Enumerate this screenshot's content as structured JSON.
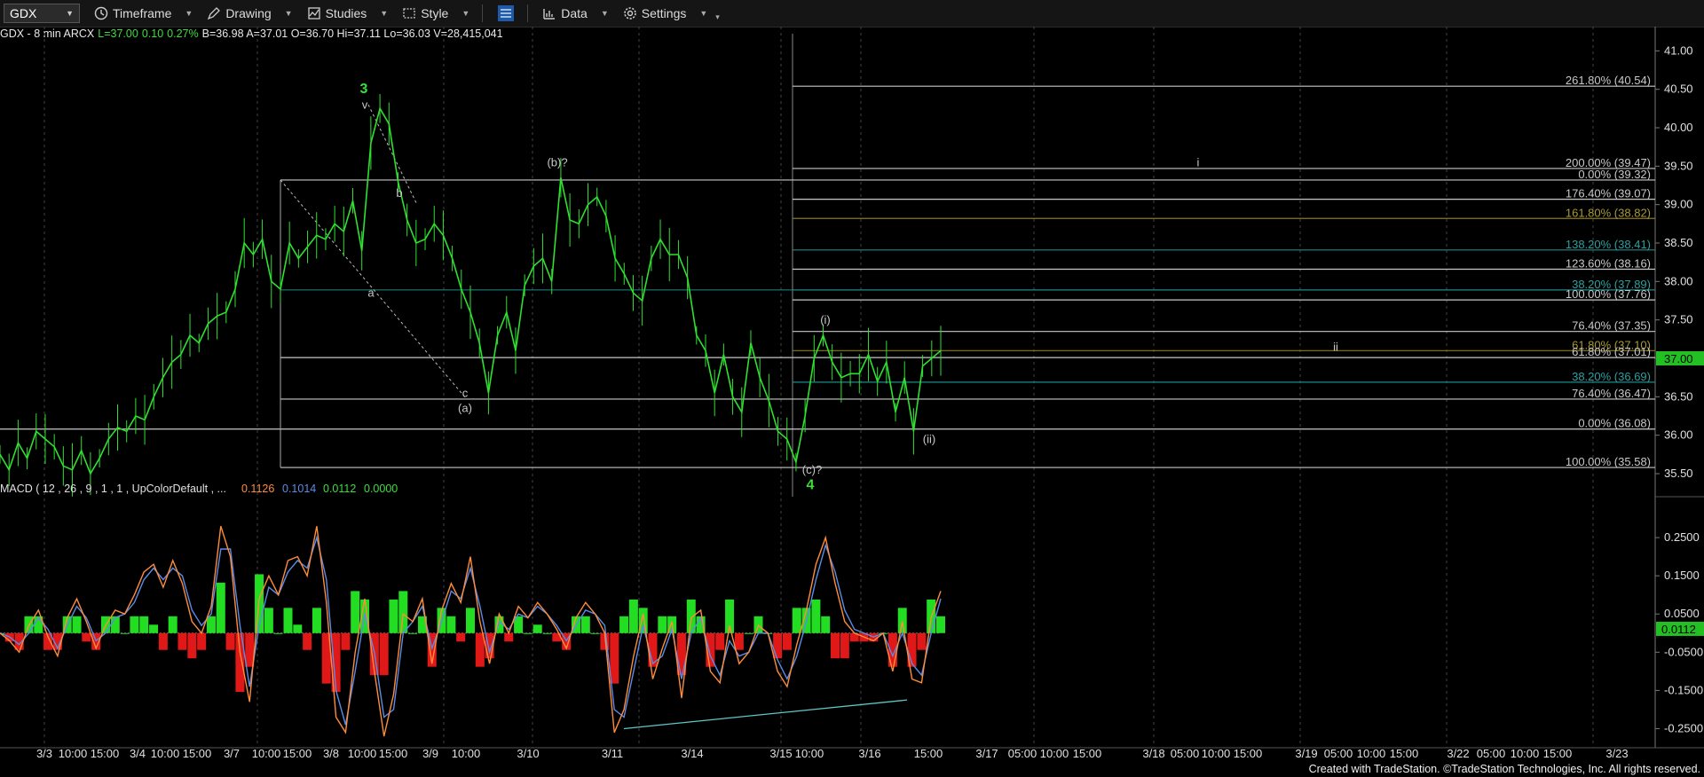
{
  "toolbar": {
    "symbol": "GDX",
    "items": [
      {
        "label": "Timeframe",
        "icon": "clock-icon"
      },
      {
        "label": "Drawing",
        "icon": "pencil-icon"
      },
      {
        "label": "Studies",
        "icon": "studies-icon"
      },
      {
        "label": "Style",
        "icon": "style-icon"
      },
      {
        "label": "Data",
        "icon": "data-icon"
      },
      {
        "label": "Settings",
        "icon": "gear-icon"
      }
    ]
  },
  "info_line": {
    "prefix": "GDX - 8 min  ARCX",
    "last": "L=37.00",
    "change": "0.10",
    "pct": "0.27%",
    "stats": "B=36.98  A=37.01  O=36.70  Hi=37.11  Lo=36.03  V=28,415,041"
  },
  "colors": {
    "price": "#2fe02f",
    "macd": "#ff8c3a",
    "signal": "#5a8ce8",
    "hist_up": "#22dd22",
    "hist_down": "#e01818",
    "fib_gray": "#c8c8c8",
    "fib_teal": "#1e8a8a",
    "fib_olive": "#8a7a1e",
    "divergence": "#5fc7c7"
  },
  "chart_data": [
    {
      "type": "line",
      "title": "GDX - 8 min",
      "ylim": [
        35.2,
        41.2
      ],
      "y_ticks": [
        "41.00",
        "40.50",
        "40.00",
        "39.50",
        "39.00",
        "38.50",
        "38.00",
        "37.50",
        "37.00",
        "36.50",
        "36.00",
        "35.50"
      ],
      "x_tick_labels": [
        "3/3",
        "10:00",
        "15:00",
        "3/4",
        "10:00",
        "15:00",
        "3/7",
        "10:00",
        "15:00",
        "3/8",
        "10:00",
        "15:00",
        "3/9",
        "10:00",
        "3/10",
        "3/11",
        "3/14",
        "3/15",
        "10:00",
        "3/16",
        "15:00",
        "3/17",
        "05:00",
        "10:00",
        "15:00",
        "3/18",
        "05:00",
        "10:00",
        "15:00",
        "3/19",
        "05:00",
        "10:00",
        "15:00",
        "3/22",
        "05:00",
        "10:00",
        "15:00",
        "3/23"
      ],
      "series": [
        {
          "values": [
            35.75,
            35.55,
            35.9,
            35.7,
            36.05,
            35.95,
            35.85,
            35.6,
            35.55,
            35.8,
            35.5,
            35.7,
            35.95,
            36.1,
            36.05,
            36.25,
            36.2,
            36.5,
            36.75,
            36.95,
            37.05,
            37.3,
            37.2,
            37.45,
            37.55,
            37.6,
            37.9,
            38.5,
            38.35,
            38.55,
            38.0,
            37.9,
            38.5,
            38.3,
            38.45,
            38.6,
            38.55,
            38.75,
            38.65,
            39.05,
            38.4,
            39.8,
            40.25,
            40.05,
            39.3,
            38.8,
            38.5,
            38.55,
            38.75,
            38.6,
            38.3,
            37.9,
            37.6,
            37.2,
            36.55,
            37.3,
            37.6,
            37.1,
            37.95,
            38.2,
            38.3,
            38.0,
            39.35,
            38.8,
            38.75,
            39.0,
            39.1,
            38.85,
            38.3,
            38.1,
            37.85,
            37.75,
            38.3,
            38.55,
            38.35,
            38.35,
            38.05,
            37.3,
            37.1,
            36.55,
            37.05,
            36.5,
            36.3,
            37.2,
            36.75,
            36.45,
            36.05,
            35.95,
            35.65,
            36.25,
            37.0,
            37.3,
            36.95,
            36.75,
            36.8,
            36.8,
            37.05,
            36.7,
            36.95,
            36.3,
            36.75,
            36.05,
            36.9,
            37.0,
            37.1
          ],
          "last": "37.00"
        }
      ],
      "fib_levels": [
        {
          "label": "261.80% (40.54)",
          "y": 40.54,
          "color": "gray"
        },
        {
          "label": "200.00% (39.47)",
          "y": 39.47,
          "color": "gray"
        },
        {
          "label": "0.00% (39.32)",
          "y": 39.32,
          "color": "gray"
        },
        {
          "label": "176.40% (39.07)",
          "y": 39.07,
          "color": "gray"
        },
        {
          "label": "161.80% (38.82)",
          "y": 38.82,
          "color": "olive"
        },
        {
          "label": "138.20% (38.41)",
          "y": 38.41,
          "color": "teal"
        },
        {
          "label": "123.60% (38.16)",
          "y": 38.16,
          "color": "gray"
        },
        {
          "label": "38.20% (37.89)",
          "y": 37.89,
          "color": "teal"
        },
        {
          "label": "100.00% (37.76)",
          "y": 37.76,
          "color": "gray"
        },
        {
          "label": "76.40% (37.35)",
          "y": 37.35,
          "color": "gray"
        },
        {
          "label": "61.80% (37.10)",
          "y": 37.1,
          "color": "olive"
        },
        {
          "label": "61.80% (37.01)",
          "y": 37.01,
          "color": "gray"
        },
        {
          "label": "38.20% (36.69)",
          "y": 36.69,
          "color": "teal"
        },
        {
          "label": "76.40% (36.47)",
          "y": 36.47,
          "color": "gray"
        },
        {
          "label": "0.00% (36.08)",
          "y": 36.08,
          "color": "gray"
        },
        {
          "label": "100.00% (35.58)",
          "y": 35.58,
          "color": "gray"
        }
      ],
      "annotations": [
        {
          "text": "3",
          "y": 40.45,
          "style": "big"
        },
        {
          "text": "v",
          "y": 40.25,
          "style": "small"
        },
        {
          "text": "b",
          "y": 39.1,
          "style": "small"
        },
        {
          "text": "a",
          "y": 37.8,
          "style": "small"
        },
        {
          "text": "c",
          "y": 36.5,
          "style": "small"
        },
        {
          "text": "(a)",
          "y": 36.3,
          "style": "small"
        },
        {
          "text": "(b)?",
          "y": 39.5,
          "style": "small"
        },
        {
          "text": "(i)",
          "y": 37.45,
          "style": "small"
        },
        {
          "text": "(c)?",
          "y": 35.5,
          "style": "small"
        },
        {
          "text": "4",
          "y": 35.3,
          "style": "big"
        },
        {
          "text": "(ii)",
          "y": 35.9,
          "style": "small"
        },
        {
          "text": "i",
          "y": 39.5,
          "style": "small"
        },
        {
          "text": "ii",
          "y": 37.1,
          "style": "small"
        }
      ]
    },
    {
      "type": "line",
      "title": "MACD ( 12 , 26 , 9 , 1 , 1 , UpColorDefault , ...",
      "legend_values": [
        "0.1126",
        "0.1014",
        "0.0112",
        "0.0000"
      ],
      "ylim": [
        -0.3,
        0.35
      ],
      "y_ticks": [
        "0.2500",
        "0.1500",
        "0.0500",
        "-0.0500",
        "-0.1500",
        "-0.2500"
      ],
      "last": "0.0112",
      "macd": [
        0.0,
        -0.02,
        -0.05,
        0.02,
        0.06,
        -0.01,
        -0.06,
        0.04,
        0.09,
        0.03,
        -0.04,
        0.02,
        0.06,
        0.05,
        0.1,
        0.16,
        0.18,
        0.12,
        0.19,
        0.13,
        0.03,
        0.0,
        0.07,
        0.28,
        0.2,
        -0.05,
        -0.18,
        0.09,
        0.15,
        0.1,
        0.19,
        0.2,
        0.15,
        0.28,
        0.08,
        -0.22,
        -0.26,
        -0.05,
        0.09,
        -0.1,
        -0.27,
        -0.16,
        0.05,
        0.03,
        0.09,
        -0.08,
        0.06,
        0.13,
        0.08,
        0.2,
        0.03,
        -0.08,
        0.05,
        0.0,
        0.07,
        0.04,
        0.08,
        0.05,
        0.01,
        -0.04,
        0.04,
        0.08,
        0.05,
        0.0,
        -0.26,
        -0.2,
        -0.06,
        0.05,
        -0.12,
        -0.04,
        0.03,
        -0.17,
        0.04,
        0.06,
        -0.1,
        -0.13,
        0.02,
        -0.08,
        -0.05,
        0.02,
        0.0,
        -0.1,
        -0.14,
        -0.03,
        0.06,
        0.18,
        0.25,
        0.13,
        0.03,
        0.0,
        -0.01,
        -0.02,
        0.0,
        -0.1,
        0.03,
        -0.12,
        -0.13,
        0.04,
        0.11
      ],
      "signal_line": [
        0.0,
        -0.01,
        -0.03,
        0.0,
        0.04,
        0.01,
        -0.04,
        0.02,
        0.07,
        0.04,
        -0.02,
        0.0,
        0.04,
        0.05,
        0.08,
        0.14,
        0.17,
        0.14,
        0.17,
        0.15,
        0.06,
        0.02,
        0.05,
        0.22,
        0.22,
        0.02,
        -0.14,
        0.02,
        0.12,
        0.1,
        0.16,
        0.19,
        0.17,
        0.25,
        0.14,
        -0.15,
        -0.24,
        -0.1,
        0.05,
        -0.05,
        -0.22,
        -0.2,
        0.0,
        0.03,
        0.07,
        -0.04,
        0.03,
        0.11,
        0.09,
        0.17,
        0.07,
        -0.05,
        0.03,
        0.01,
        0.05,
        0.04,
        0.07,
        0.05,
        0.02,
        -0.02,
        0.02,
        0.06,
        0.05,
        0.02,
        -0.2,
        -0.22,
        -0.1,
        0.02,
        -0.08,
        -0.06,
        0.01,
        -0.12,
        0.0,
        0.04,
        -0.06,
        -0.11,
        -0.02,
        -0.06,
        -0.05,
        0.0,
        0.0,
        -0.07,
        -0.12,
        -0.06,
        0.03,
        0.14,
        0.23,
        0.16,
        0.06,
        0.01,
        0.0,
        -0.01,
        0.0,
        -0.06,
        0.0,
        -0.08,
        -0.11,
        0.0,
        0.09
      ],
      "divergence_line": {
        "from": -0.25,
        "to": -0.175
      }
    }
  ],
  "footer": "Created with TradeStation. ©TradeStation Technologies, Inc. All rights reserved."
}
